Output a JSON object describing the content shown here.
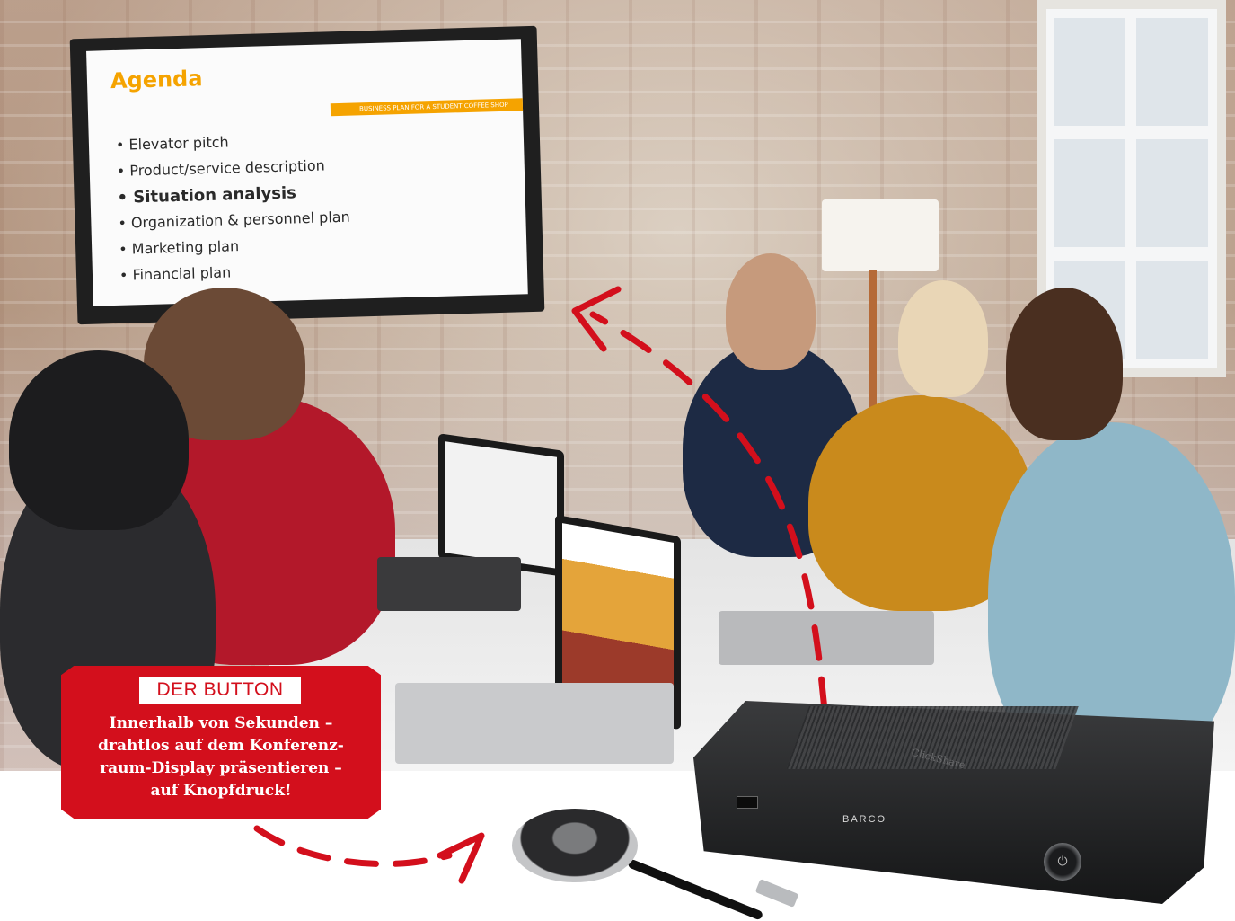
{
  "screen_slide": {
    "title": "Agenda",
    "banner": "BUSINESS PLAN FOR A STUDENT COFFEE SHOP",
    "items": [
      "• Elevator pitch",
      "• Product/service description",
      "• Situation analysis",
      "• Organization & personnel plan",
      "• Marketing plan",
      "• Financial plan"
    ]
  },
  "callout": {
    "tag": "DER BUTTON",
    "lines": [
      "Innerhalb von Sekunden –",
      "drahtlos auf dem Konferenz-",
      "raum-Display präsentieren –",
      "auf Knopfdruck!"
    ]
  },
  "device": {
    "name": "ClickShare",
    "brand": "BARCO"
  },
  "colors": {
    "accent_red": "#d30f1c",
    "slide_orange": "#f5a300"
  }
}
